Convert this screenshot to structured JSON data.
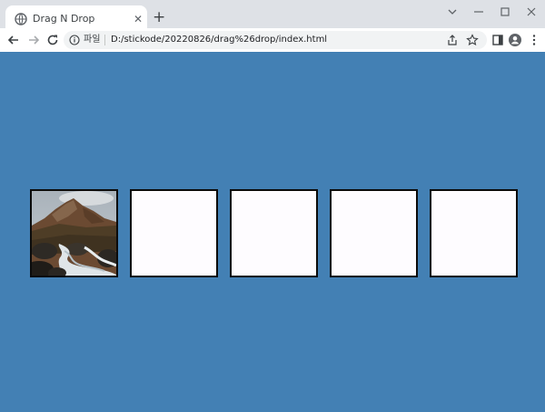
{
  "browser": {
    "tab": {
      "title": "Drag N Drop",
      "favicon": "globe-icon",
      "close_glyph": "✕"
    },
    "new_tab_glyph": "+",
    "address": {
      "security_label": "파일",
      "url": "D:/stickode/20220826/drag%26drop/index.html"
    },
    "accent": "#dee1e6"
  },
  "page": {
    "background": "#4380b4",
    "boxes": [
      {
        "label": "box-1",
        "has_image": true
      },
      {
        "label": "box-2",
        "has_image": false
      },
      {
        "label": "box-3",
        "has_image": false
      },
      {
        "label": "box-4",
        "has_image": false
      },
      {
        "label": "box-5",
        "has_image": false
      }
    ]
  }
}
